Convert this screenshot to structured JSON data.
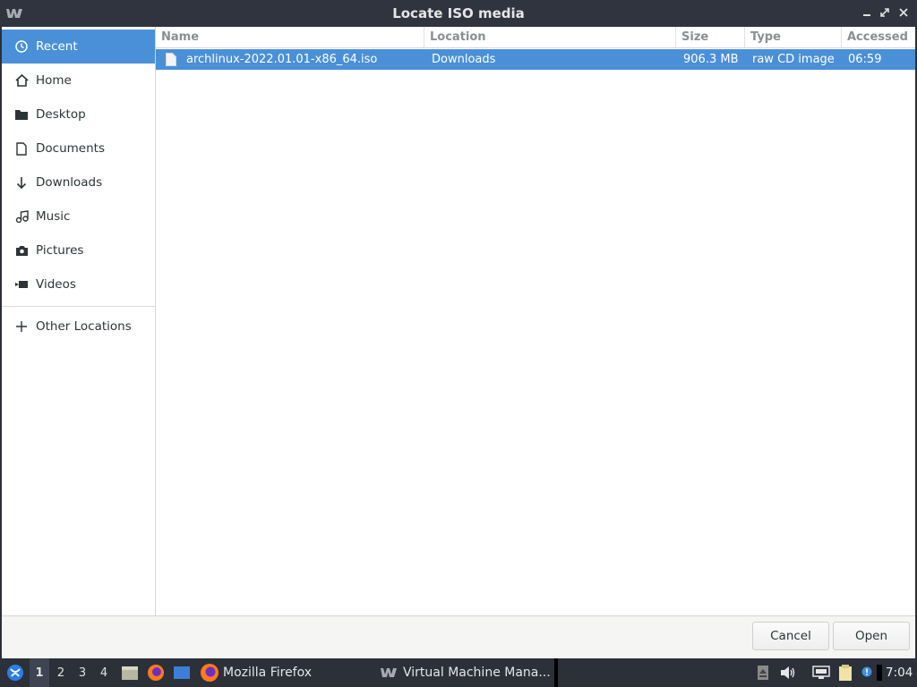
{
  "window": {
    "title": "Locate ISO media"
  },
  "sidebar": {
    "items": [
      {
        "label": "Recent",
        "icon": "clock-icon"
      },
      {
        "label": "Home",
        "icon": "home-icon"
      },
      {
        "label": "Desktop",
        "icon": "folder-icon"
      },
      {
        "label": "Documents",
        "icon": "document-icon"
      },
      {
        "label": "Downloads",
        "icon": "download-arrow-icon"
      },
      {
        "label": "Music",
        "icon": "music-note-icon"
      },
      {
        "label": "Pictures",
        "icon": "camera-icon"
      },
      {
        "label": "Videos",
        "icon": "video-icon"
      },
      {
        "label": "Other Locations",
        "icon": "plus-icon"
      }
    ]
  },
  "file_list": {
    "columns": [
      "Name",
      "Location",
      "Size",
      "Type",
      "Accessed"
    ],
    "rows": [
      {
        "name": "archlinux-2022.01.01-x86_64.iso",
        "location": "Downloads",
        "size": "906.3 MB",
        "type": "raw CD image",
        "accessed": "06:59",
        "selected": true
      }
    ]
  },
  "buttons": {
    "cancel": "Cancel",
    "open": "Open"
  },
  "taskbar": {
    "workspaces": [
      "1",
      "2",
      "3",
      "4"
    ],
    "active_workspace": "1",
    "tasks": [
      {
        "label": "Mozilla Firefox",
        "icon": "firefox-icon"
      },
      {
        "label": "Virtual Machine Mana...",
        "icon": "virt-manager-icon"
      }
    ],
    "clock": "7:04"
  },
  "colors": {
    "selection": "#4a90d9",
    "titlebar": "#2f343f",
    "taskbar": "#2b3039"
  }
}
